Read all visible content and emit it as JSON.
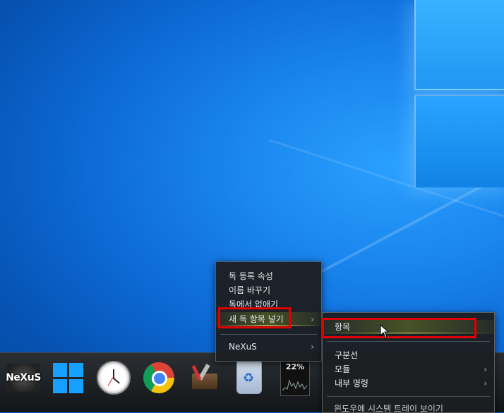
{
  "dock": {
    "items": [
      {
        "name": "NeXuS",
        "icon": "nexus-logo-icon"
      },
      {
        "name": "Windows",
        "icon": "windows-logo-icon"
      },
      {
        "name": "Clock",
        "icon": "clock-icon"
      },
      {
        "name": "Chrome",
        "icon": "chrome-icon"
      },
      {
        "name": "Tools",
        "icon": "tools-icon"
      },
      {
        "name": "Recycle Bin",
        "icon": "recycle-bin-icon"
      },
      {
        "name": "CPU Meter",
        "icon": "cpu-meter-icon"
      }
    ],
    "nexus_label": "NeXuS",
    "cpu_percent": "22%"
  },
  "menu": {
    "items": [
      {
        "label": "독 등록 속성"
      },
      {
        "label": "이름 바꾸기"
      },
      {
        "label": "독에서 없애기"
      },
      {
        "label": "새 독 항목 넣기",
        "submenu": true
      },
      {
        "label": "NeXuS",
        "submenu": true
      }
    ]
  },
  "submenu": {
    "items": [
      {
        "label": "항목"
      },
      {
        "label": "구분선"
      },
      {
        "label": "모듈",
        "submenu": true
      },
      {
        "label": "내부 명령",
        "submenu": true
      },
      {
        "label": "윈도우에 시스템 트레이 보이기"
      }
    ]
  },
  "colors": {
    "highlight_box": "#e00000",
    "desktop": "#0d6ad6",
    "dock": "#1f2226"
  }
}
